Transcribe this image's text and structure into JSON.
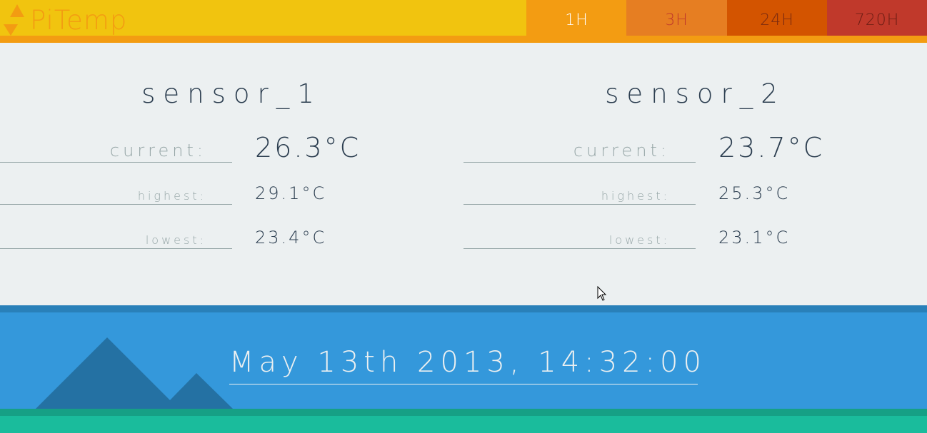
{
  "app": {
    "name": "PiTemp",
    "logo_icon": "thermometer-arrows-icon"
  },
  "ranges": [
    {
      "label": "1H",
      "active": true
    },
    {
      "label": "3H",
      "active": false
    },
    {
      "label": "24H",
      "active": false
    },
    {
      "label": "720H",
      "active": false
    }
  ],
  "sensors": [
    {
      "name": "sensor_1",
      "current_label": "current:",
      "current": "26.3°C",
      "highest_label": "highest:",
      "highest": "29.1°C",
      "lowest_label": "lowest:",
      "lowest": "23.4°C"
    },
    {
      "name": "sensor_2",
      "current_label": "current:",
      "current": "23.7°C",
      "highest_label": "highest:",
      "highest": "25.3°C",
      "lowest_label": "lowest:",
      "lowest": "23.1°C"
    }
  ],
  "footer": {
    "datetime": "May 13th 2013, 14:32:00",
    "decoration_icon": "mountains-icon"
  },
  "colors": {
    "header": "#f1c40f",
    "accent": "#f39c12",
    "background": "#ecf0f1",
    "footer": "#3498db",
    "ground": "#1abc9c"
  }
}
